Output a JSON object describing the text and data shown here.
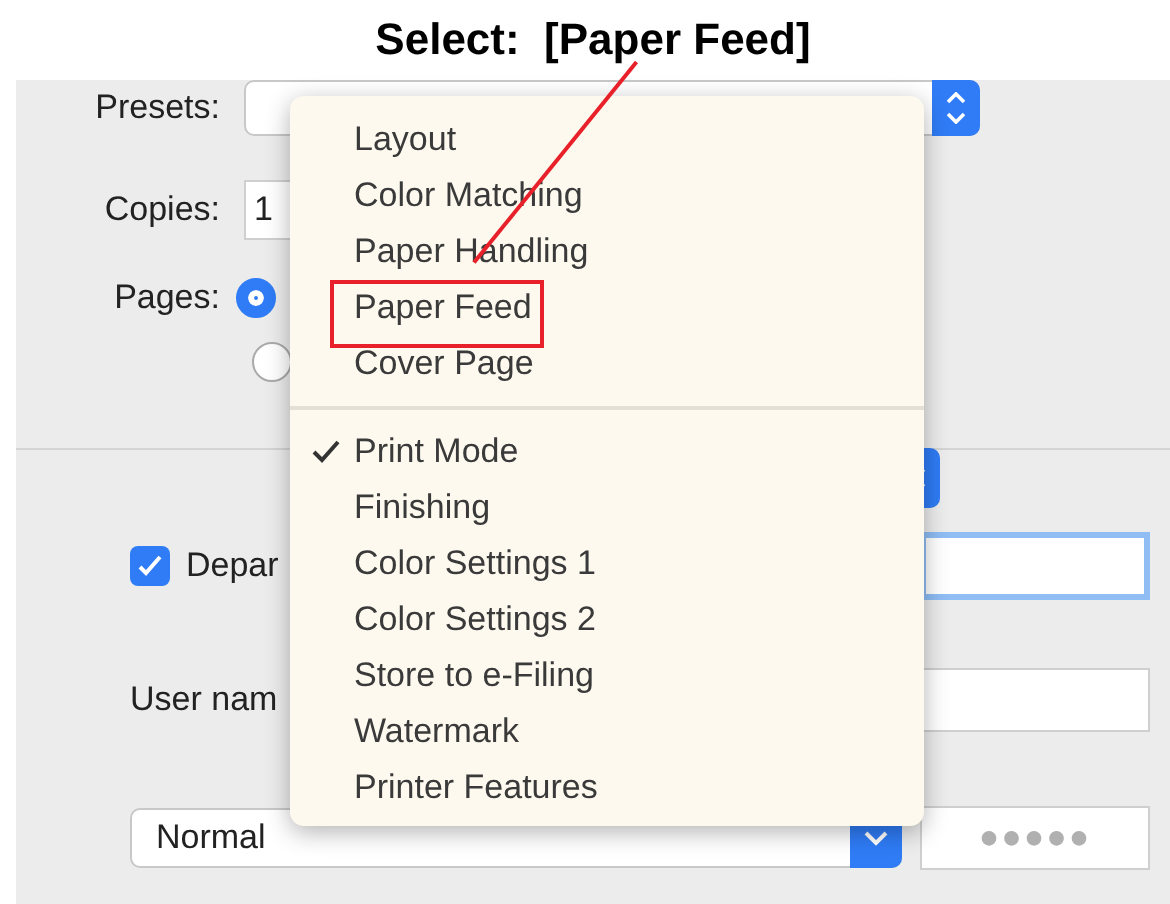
{
  "heading": "Select:  [Paper Feed]",
  "dialog": {
    "presets_label": "Presets:",
    "copies_label": "Copies:",
    "copies_value": "1",
    "pages_label": "Pages:",
    "page_radios": [
      {
        "selected": true
      },
      {
        "selected": false
      }
    ],
    "department": {
      "label": "Depar",
      "checked": true
    },
    "user_name_label": "User nam",
    "mode_select": "Normal",
    "password_placeholder": "●●●●●"
  },
  "menu": {
    "groups": [
      [
        {
          "label": "Layout",
          "checked": false,
          "annotated": false
        },
        {
          "label": "Color Matching",
          "checked": false,
          "annotated": false
        },
        {
          "label": "Paper Handling",
          "checked": false,
          "annotated": false
        },
        {
          "label": "Paper Feed",
          "checked": false,
          "annotated": true
        },
        {
          "label": "Cover Page",
          "checked": false,
          "annotated": false
        }
      ],
      [
        {
          "label": "Print Mode",
          "checked": true,
          "annotated": false
        },
        {
          "label": "Finishing",
          "checked": false,
          "annotated": false
        },
        {
          "label": "Color Settings 1",
          "checked": false,
          "annotated": false
        },
        {
          "label": "Color Settings 2",
          "checked": false,
          "annotated": false
        },
        {
          "label": "Store to e-Filing",
          "checked": false,
          "annotated": false
        },
        {
          "label": "Watermark",
          "checked": false,
          "annotated": false
        },
        {
          "label": "Printer Features",
          "checked": false,
          "annotated": false
        }
      ]
    ]
  }
}
